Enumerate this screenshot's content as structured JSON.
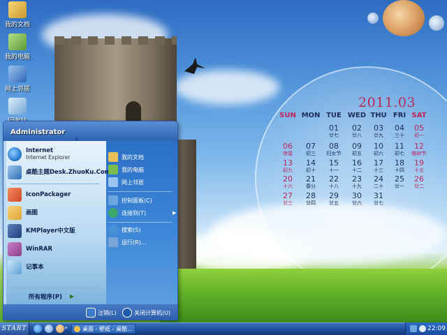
{
  "desktop": {
    "icons": [
      {
        "label": "我的文档",
        "color": "#e8c15a"
      },
      {
        "label": "我的电脑",
        "color": "#7bbd4c"
      },
      {
        "label": "网上邻居",
        "color": "#4b86d0"
      },
      {
        "label": "回收站",
        "color": "#9ec7ea"
      }
    ]
  },
  "calendar": {
    "title": "2011.03",
    "weekdays": [
      "SUN",
      "MON",
      "TUE",
      "WED",
      "THU",
      "FRI",
      "SAT"
    ],
    "colors": {
      "weekend": "#c0245a",
      "weekday": "#1c2d5a",
      "title": "#b62a53"
    },
    "weeks": [
      [
        null,
        null,
        {
          "n": "01",
          "s": "廿七"
        },
        {
          "n": "02",
          "s": "廿八"
        },
        {
          "n": "03",
          "s": "廿九"
        },
        {
          "n": "04",
          "s": "三十"
        },
        {
          "n": "05",
          "s": "初一"
        }
      ],
      [
        {
          "n": "06",
          "s": "惊蛰"
        },
        {
          "n": "07",
          "s": "初三"
        },
        {
          "n": "08",
          "s": "妇女节"
        },
        {
          "n": "09",
          "s": "初五"
        },
        {
          "n": "10",
          "s": "初六"
        },
        {
          "n": "11",
          "s": "初七"
        },
        {
          "n": "12",
          "s": "植树节"
        }
      ],
      [
        {
          "n": "13",
          "s": "初九"
        },
        {
          "n": "14",
          "s": "初十"
        },
        {
          "n": "15",
          "s": "十一"
        },
        {
          "n": "16",
          "s": "十二"
        },
        {
          "n": "17",
          "s": "十三"
        },
        {
          "n": "18",
          "s": "十四"
        },
        {
          "n": "19",
          "s": "十五"
        }
      ],
      [
        {
          "n": "20",
          "s": "十六"
        },
        {
          "n": "21",
          "s": "春分"
        },
        {
          "n": "22",
          "s": "十八"
        },
        {
          "n": "23",
          "s": "十九"
        },
        {
          "n": "24",
          "s": "二十"
        },
        {
          "n": "25",
          "s": "廿一"
        },
        {
          "n": "26",
          "s": "廿二"
        }
      ],
      [
        {
          "n": "27",
          "s": "廿三"
        },
        {
          "n": "28",
          "s": "廿四"
        },
        {
          "n": "29",
          "s": "廿五"
        },
        {
          "n": "30",
          "s": "廿六"
        },
        {
          "n": "31",
          "s": "廿七"
        },
        null,
        null
      ]
    ]
  },
  "start_menu": {
    "user": "Administrator",
    "pinned": [
      {
        "name": "internet",
        "label": "Internet",
        "sub": "Internet Explorer",
        "color": "#2f7fd6"
      },
      {
        "name": "desk-zhuoku",
        "label": "桌酷主题Desk.ZhuoKu.Com",
        "sub": "",
        "color": "#2d6fb8"
      }
    ],
    "recent": [
      {
        "name": "iconpackager",
        "label": "IconPackager",
        "color": "#d2472a"
      },
      {
        "name": "paint",
        "label": "画图",
        "color": "#e0a534"
      },
      {
        "name": "kmplayer",
        "label": "KMPlayer中文版",
        "color": "#1f3f7a"
      },
      {
        "name": "winrar",
        "label": "WinRAR",
        "color": "#8e3e8e"
      },
      {
        "name": "notepad",
        "label": "记事本",
        "color": "#5aa0d8"
      }
    ],
    "all_programs": "所有程序(P)",
    "right": [
      {
        "name": "my-documents",
        "label": "我的文档",
        "color": "#e8c15a"
      },
      {
        "name": "my-computer",
        "label": "我的电脑",
        "color": "#7bbd4c"
      },
      {
        "name": "network",
        "label": "网上邻居",
        "color": "#4b86d0"
      },
      {
        "name": "control-panel",
        "label": "控制面板(C)",
        "color": "#6aa7e0"
      },
      {
        "name": "connect-to",
        "label": "连接到(T)",
        "color": "#39a86a"
      },
      {
        "name": "search",
        "label": "搜索(S)",
        "color": "#4a90d8"
      },
      {
        "name": "run",
        "label": "运行(R)...",
        "color": "#7aa7d8"
      }
    ],
    "logoff": "注销(L)",
    "shutdown": "关闭计算机(U)"
  },
  "taskbar": {
    "start_label": "START",
    "task": "桌面 - 壁纸 - 桌酷...",
    "clock": "22:09"
  }
}
